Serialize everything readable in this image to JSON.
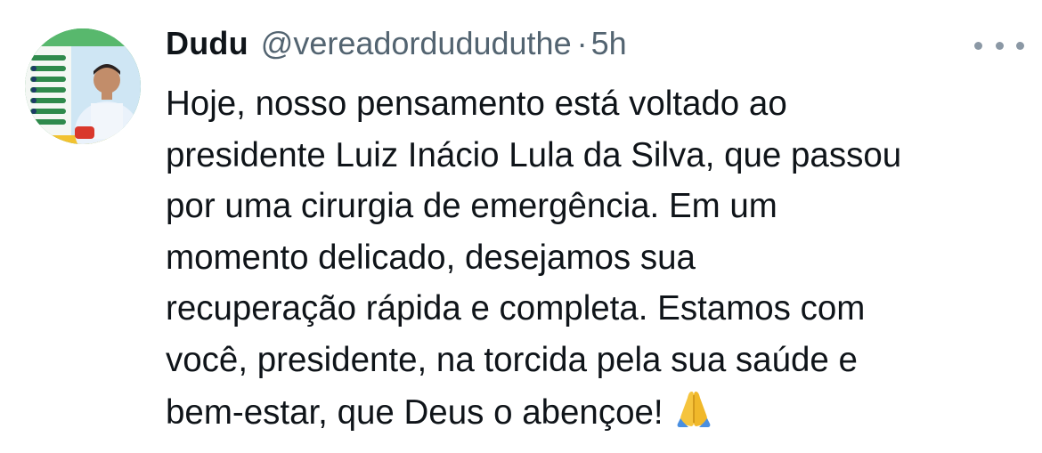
{
  "tweet": {
    "display_name": "Dudu",
    "handle": "@vereadordududuthe",
    "separator": "·",
    "time": "5h",
    "more_icon": "more-horizontal-icon",
    "text_lines": [
      "Hoje, nosso pensamento está voltado ao",
      "presidente Luiz Inácio Lula da Silva, que passou",
      "por uma cirurgia de emergência. Em um",
      "momento delicado, desejamos sua",
      "recuperação rápida e completa. Estamos com",
      "você, presidente, na torcida pela sua saúde e",
      "bem-estar, que Deus o abençoe!"
    ],
    "emoji": "folded-hands-emoji",
    "avatar_icon": "profile-avatar"
  },
  "colors": {
    "text": "#0f1419",
    "secondary": "#536471",
    "icon": "#8b98a5",
    "background": "#ffffff"
  }
}
